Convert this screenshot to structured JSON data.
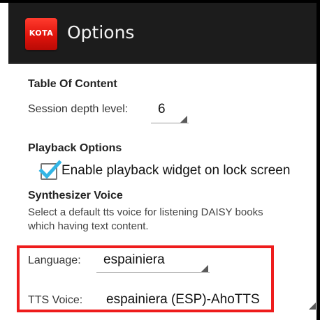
{
  "appbar": {
    "logo_text": "KOTA",
    "title": "Options"
  },
  "toc": {
    "heading": "Table Of Content",
    "session_depth_label": "Session depth level:",
    "session_depth_value": "6"
  },
  "playback": {
    "heading": "Playback Options",
    "lock_widget_label": "Enable playback widget on lock screen",
    "lock_widget_checked": true
  },
  "synth": {
    "heading": "Synthesizer Voice",
    "description_line1": "Select a default tts voice for listening DAISY books",
    "description_line2": "which having text content.",
    "language_label": "Language:",
    "language_value": "espainiera",
    "voice_label": "TTS Voice:",
    "voice_value": "espainiera (ESP)-AhoTTS"
  },
  "colors": {
    "accent": "#33b5e5",
    "highlight": "#ee1c1c",
    "appbar": "#1c1c1c"
  }
}
